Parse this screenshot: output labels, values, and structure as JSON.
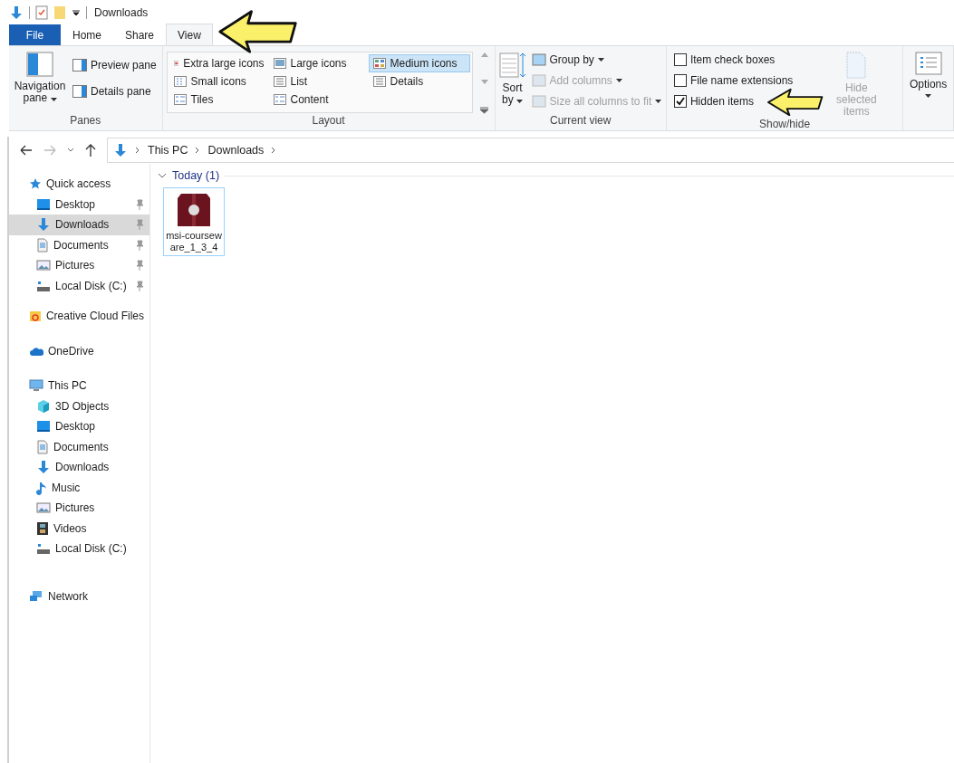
{
  "title_bar": {
    "title": "Downloads"
  },
  "tabs": [
    {
      "label": "File",
      "kind": "file",
      "selected": false
    },
    {
      "label": "Home",
      "kind": "tab",
      "selected": false
    },
    {
      "label": "Share",
      "kind": "tab",
      "selected": false
    },
    {
      "label": "View",
      "kind": "tab",
      "selected": true
    }
  ],
  "ribbon": {
    "panes": {
      "label": "Panes",
      "navigation_pane": "Navigation pane",
      "preview_pane": "Preview pane",
      "details_pane": "Details pane"
    },
    "layout": {
      "label": "Layout",
      "items": [
        {
          "label": "Extra large icons",
          "kind": "xl",
          "selected": false
        },
        {
          "label": "Large icons",
          "kind": "large",
          "selected": false
        },
        {
          "label": "Medium icons",
          "kind": "medium",
          "selected": true
        },
        {
          "label": "Small icons",
          "kind": "small",
          "selected": false
        },
        {
          "label": "List",
          "kind": "list",
          "selected": false
        },
        {
          "label": "Details",
          "kind": "details",
          "selected": false
        },
        {
          "label": "Tiles",
          "kind": "tiles",
          "selected": false
        },
        {
          "label": "Content",
          "kind": "content",
          "selected": false
        }
      ]
    },
    "current_view": {
      "label": "Current view",
      "sort_by": "Sort by",
      "items": [
        {
          "label": "Group by",
          "disabled": false
        },
        {
          "label": "Add columns",
          "disabled": true
        },
        {
          "label": "Size all columns to fit",
          "disabled": true
        }
      ]
    },
    "show_hide": {
      "label": "Show/hide",
      "checkboxes": [
        {
          "label": "Item check boxes",
          "checked": false
        },
        {
          "label": "File name extensions",
          "checked": false
        },
        {
          "label": "Hidden items",
          "checked": true
        }
      ],
      "hide_selected": {
        "label": "Hide selected items",
        "disabled": true
      }
    },
    "options": {
      "label": "Options"
    }
  },
  "address_bar": {
    "path": [
      "This PC",
      "Downloads"
    ]
  },
  "navigation": [
    {
      "label": "Quick access",
      "kind": "star",
      "selected": false,
      "children": [
        {
          "label": "Desktop",
          "kind": "desktop",
          "pinned": true,
          "selected": false
        },
        {
          "label": "Downloads",
          "kind": "download",
          "pinned": true,
          "selected": true
        },
        {
          "label": "Documents",
          "kind": "document",
          "pinned": true,
          "selected": false
        },
        {
          "label": "Pictures",
          "kind": "pictures",
          "pinned": true,
          "selected": false
        },
        {
          "label": "Local Disk (C:)",
          "kind": "disk",
          "pinned": true,
          "selected": false
        }
      ]
    },
    {
      "label": "Creative Cloud Files",
      "kind": "cc",
      "selected": false
    },
    {
      "label": "OneDrive",
      "kind": "cloud",
      "selected": false
    },
    {
      "label": "This PC",
      "kind": "pc",
      "selected": false,
      "children": [
        {
          "label": "3D Objects",
          "kind": "cube",
          "selected": false
        },
        {
          "label": "Desktop",
          "kind": "desktop",
          "selected": false
        },
        {
          "label": "Documents",
          "kind": "document",
          "selected": false
        },
        {
          "label": "Downloads",
          "kind": "download",
          "selected": false
        },
        {
          "label": "Music",
          "kind": "music",
          "selected": false
        },
        {
          "label": "Pictures",
          "kind": "pictures",
          "selected": false
        },
        {
          "label": "Videos",
          "kind": "video",
          "selected": false
        },
        {
          "label": "Local Disk (C:)",
          "kind": "disk",
          "selected": false
        }
      ]
    },
    {
      "label": "Network",
      "kind": "network",
      "selected": false
    }
  ],
  "content": {
    "groups": [
      {
        "label": "Today (1)",
        "expanded": true,
        "files": [
          {
            "name": "msi-courseware_1_3_4",
            "selected": true
          }
        ]
      }
    ]
  }
}
